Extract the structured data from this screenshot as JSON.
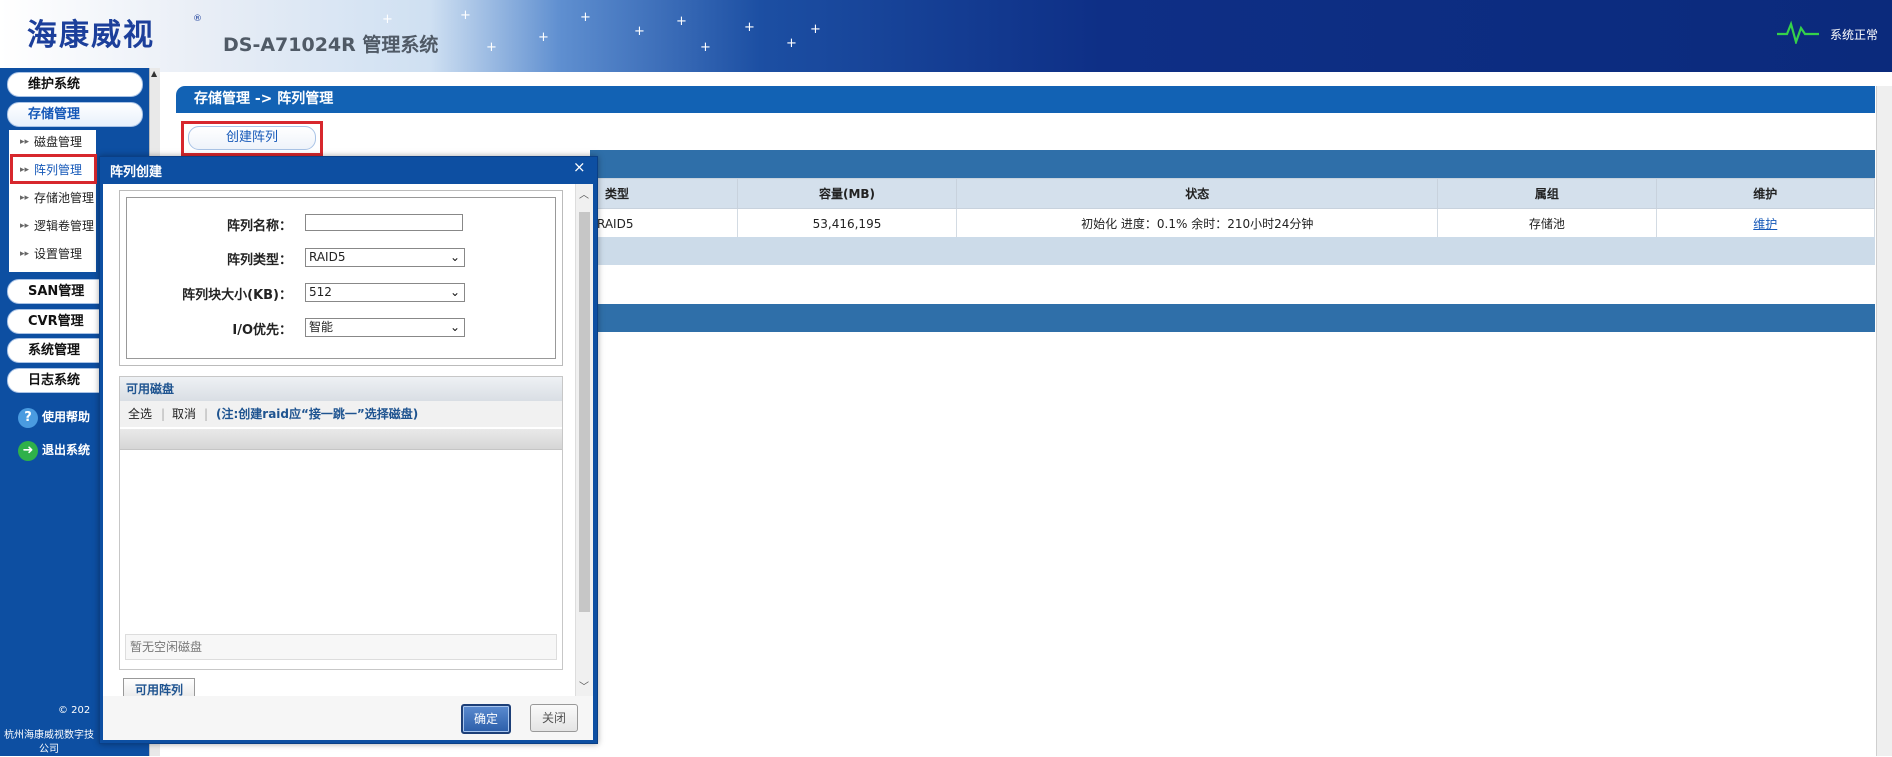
{
  "header": {
    "logo_text": "海康威视",
    "logo_mark": "®",
    "system_title": "DS-A71024R 管理系统",
    "status_text": "系统正常",
    "status_icon": "heartbeat-icon"
  },
  "sidebar": {
    "menus": [
      {
        "label": "维护系统"
      },
      {
        "label": "存储管理"
      },
      {
        "label": "SAN管理"
      },
      {
        "label": "CVR管理"
      },
      {
        "label": "系统管理"
      },
      {
        "label": "日志系统"
      }
    ],
    "submenu": [
      {
        "label": "磁盘管理"
      },
      {
        "label": "阵列管理"
      },
      {
        "label": "存储池管理"
      },
      {
        "label": "逻辑卷管理"
      },
      {
        "label": "设置管理"
      }
    ],
    "help_label": "使用帮助",
    "logout_label": "退出系统",
    "copyright": "© 202",
    "company": "杭州海康威视数字技 公司"
  },
  "main": {
    "breadcrumb": "存储管理 -> 阵列管理",
    "create_button": "创建阵列",
    "table": {
      "columns": [
        "类型",
        "容量(MB)",
        "状态",
        "属组",
        "维护"
      ],
      "rows": [
        {
          "type": "RAID5",
          "capacity": "53,416,195",
          "status": "初始化 进度：0.1% 余时：210小时24分钟",
          "group": "存储池",
          "action": "维护"
        }
      ]
    }
  },
  "dialog": {
    "title": "阵列创建",
    "close_glyph": "×",
    "form": {
      "name_label": "阵列名称：",
      "name_value": "",
      "type_label": "阵列类型：",
      "type_value": "RAID5",
      "block_label": "阵列块大小(KB)：",
      "block_value": "512",
      "io_label": "I/O优先：",
      "io_value": "智能"
    },
    "disks": {
      "title": "可用磁盘",
      "select_all": "全选",
      "cancel": "取消",
      "note": "(注:创建raid应“接一跳一”选择磁盘)",
      "empty_text": "暂无空闲磁盘"
    },
    "available_array_tab": "可用阵列",
    "ok_label": "确定",
    "close_label": "关闭"
  },
  "colors": {
    "brand_blue": "#1262b4",
    "sidebar_blue": "#0d4fa2",
    "highlight_red": "#d7272d"
  }
}
